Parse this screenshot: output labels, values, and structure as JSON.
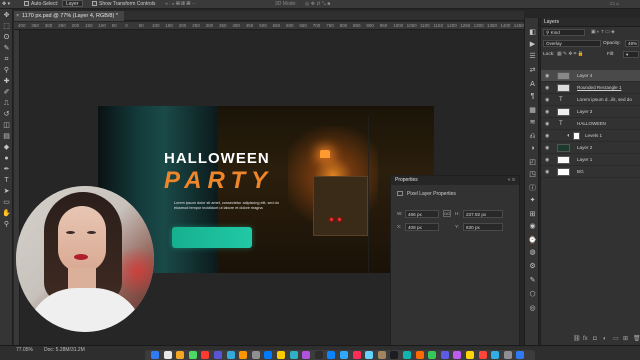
{
  "options_bar": {
    "auto_select_label": "Auto-Select:",
    "auto_select_value": "Layer",
    "transform_label": "Show Transform Controls",
    "mode_3d": "3D Mode:"
  },
  "document": {
    "tab_title": "1170 px.psd @ 77% (Layer 4, RGB/8) *",
    "tab_close": "×",
    "ruler_ticks": [
      "400",
      "350",
      "300",
      "250",
      "200",
      "150",
      "100",
      "50",
      "0",
      "50",
      "100",
      "150",
      "200",
      "250",
      "300",
      "350",
      "400",
      "450",
      "500",
      "550",
      "600",
      "650",
      "700",
      "750",
      "800",
      "850",
      "900",
      "950",
      "1000",
      "1050",
      "1100",
      "1150",
      "1200",
      "1250",
      "1300",
      "1350",
      "1400",
      "1450"
    ],
    "zoom": "77.05%",
    "doc_info": "Doc: 5.28M/31.2M"
  },
  "artboard": {
    "title_line1": "HALLOWEEN",
    "title_line2": "PARTY",
    "lorem_text": "Lorem ipsum dolor sit amet, consectetur adipiscing elit, sed do eiusmod tempor incididunt ut labore et dolore magna",
    "cta_color": "#1fbf9c",
    "title_color": "#ffffff",
    "party_color": "#f0862a"
  },
  "properties": {
    "title": "Properties",
    "subtitle": "Pixel Layer Properties",
    "w_label": "W:",
    "w_value": "486 px",
    "h_label": "H:",
    "h_value": "237.92 px",
    "x_label": "X:",
    "x_value": "408 px",
    "y_label": "Y:",
    "y_value": "630 px",
    "link_label": "GO"
  },
  "layers_panel": {
    "title": "Layers",
    "filter_value": "Kind",
    "blend_mode": "Overlay",
    "opacity_label": "Opacity:",
    "opacity_value": "48%",
    "lock_label": "Lock:",
    "fill_label": "Fill:",
    "layers": [
      {
        "name": "Layer 4",
        "kind": "pixel",
        "active": true
      },
      {
        "name": "Rounded Rectangle 1",
        "kind": "shape",
        "active": false
      },
      {
        "name": "Lorem ipsum d...ilit, sed do",
        "kind": "text",
        "active": false
      },
      {
        "name": "Layer 3",
        "kind": "pixel",
        "active": false
      },
      {
        "name": "HALLOWEEN",
        "kind": "text",
        "active": false
      },
      {
        "name": "Levels 1",
        "kind": "adjustment",
        "active": false
      },
      {
        "name": "Layer 2",
        "kind": "pixel",
        "active": false
      },
      {
        "name": "Layer 1",
        "kind": "pixel",
        "active": false
      },
      {
        "name": "BG",
        "kind": "pixel",
        "active": false
      }
    ]
  },
  "icons": {
    "tools": [
      "move-icon",
      "marquee-icon",
      "lasso-icon",
      "quick-select-icon",
      "crop-icon",
      "eyedropper-icon",
      "healing-icon",
      "brush-icon",
      "stamp-icon",
      "history-brush-icon",
      "eraser-icon",
      "gradient-icon",
      "blur-icon",
      "dodge-icon",
      "pen-icon",
      "type-icon",
      "path-select-icon",
      "shape-icon",
      "hand-icon",
      "zoom-icon"
    ],
    "dock": [
      "layers-icon",
      "play-icon",
      "adjustments-icon",
      "properties-icon",
      "character-icon",
      "paragraph-icon",
      "swatches-icon",
      "channels-icon",
      "history-icon",
      "brush-settings-icon",
      "libraries-icon",
      "navigator-icon",
      "info-icon",
      "paths-icon",
      "styles-icon",
      "glyphs-icon",
      "timeline-icon",
      "color-icon",
      "actions-icon",
      "notes-icon",
      "3d-icon",
      "measure-icon"
    ]
  }
}
